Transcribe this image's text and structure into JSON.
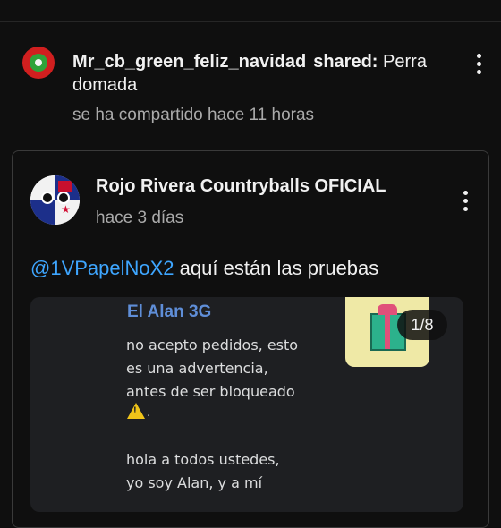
{
  "share": {
    "username": "Mr_cb_green_feliz_navidad",
    "shared_label": "shared:",
    "title": "Perra domada",
    "time": "se ha compartido hace 11 horas"
  },
  "post": {
    "channel_name": "Rojo Rivera Countryballs OFICIAL",
    "time": "hace 3 días",
    "mention": "@1VPapelNoX2",
    "text": "aquí están las pruebas"
  },
  "carousel": {
    "counter": "1/8",
    "image": {
      "name": "El Alan 3G",
      "lines": [
        "no acepto pedidos, esto",
        "es una advertencia,",
        "antes de ser bloqueado",
        "hola a todos ustedes,",
        "yo soy Alan, y a mí"
      ],
      "warn_suffix": "."
    }
  },
  "colors": {
    "background": "#0f0f0f",
    "mention": "#3ea6ff",
    "secondary_text": "#aaaaaa"
  },
  "icons": {
    "outer_menu": "kebab-menu-icon",
    "card_menu": "kebab-menu-icon",
    "warning": "warning-icon"
  }
}
